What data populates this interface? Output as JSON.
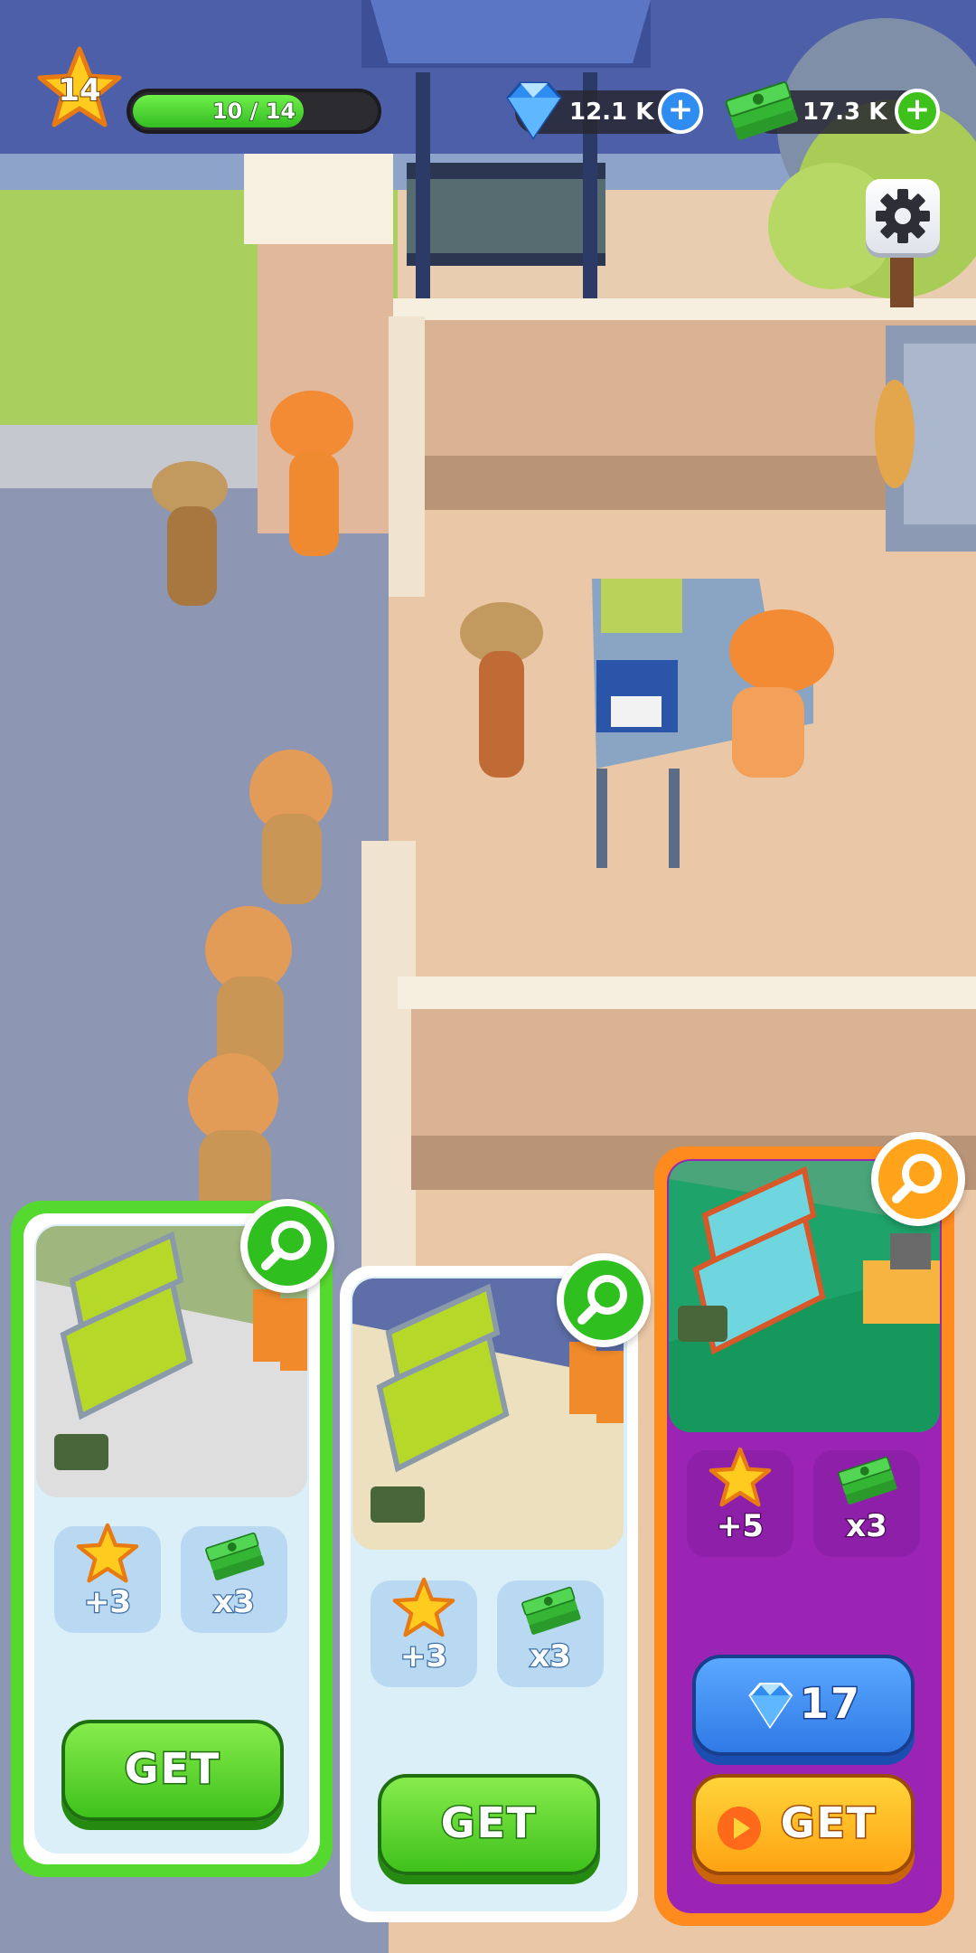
{
  "hud": {
    "level": "14",
    "xp_text": "10 / 14",
    "xp_progress": 0.71,
    "gems": "12.1 K",
    "cash": "17.3 K"
  },
  "icons": {
    "level": "star-icon",
    "gems": "diamond-icon",
    "cash": "cash-stack-icon",
    "add": "plus-icon",
    "settings": "gear-icon",
    "preview": "magnifier-icon",
    "ad": "play-icon"
  },
  "colors": {
    "green_accent": "#4cd62c",
    "purple_card": "#9b24b5",
    "orange_frame": "#ff8a1e",
    "blue_button": "#2f80ec",
    "gold_button": "#ffb31a"
  },
  "cards": [
    {
      "star_reward": "+3",
      "cash_reward": "x3",
      "button": "GET",
      "selected": true
    },
    {
      "star_reward": "+3",
      "cash_reward": "x3",
      "button": "GET",
      "selected": false
    },
    {
      "star_reward": "+5",
      "cash_reward": "x3",
      "gem_price": "17",
      "button": "GET",
      "premium": true
    }
  ]
}
